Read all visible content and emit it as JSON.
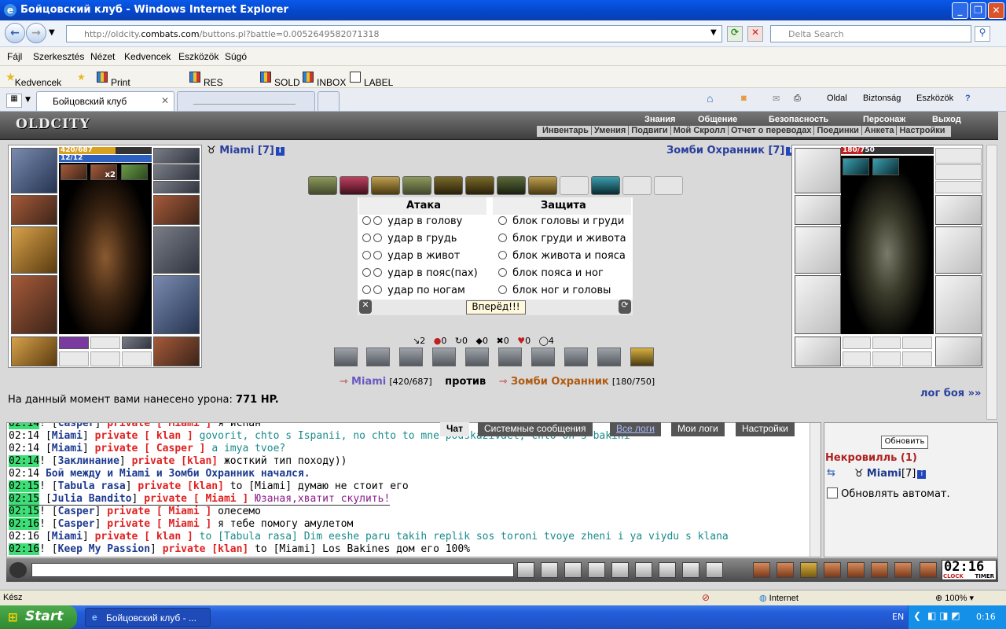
{
  "window": {
    "title": "Бойцовский клуб - Windows Internet Explorer"
  },
  "address": {
    "url_prefix": "http://oldcity.",
    "url_domain": "combats.com",
    "url_rest": "/buttons.pl?battle=0.0052649582071318",
    "search_placeholder": "Delta Search"
  },
  "menu": [
    "Fájl",
    "Szerkesztés",
    "Nézet",
    "Kedvencek",
    "Eszközök",
    "Súgó"
  ],
  "favorites": {
    "label": "Kedvencek",
    "items": [
      "Print Shipping label",
      "RES CENTER",
      "SOLD",
      "INBOX",
      "LABEL"
    ]
  },
  "tabs": [
    {
      "label": "Бойцовский клуб"
    },
    {
      "label": ""
    }
  ],
  "commandbar": [
    "Oldal",
    "Biztonság",
    "Eszközök"
  ],
  "game": {
    "logo": "OLDCITY",
    "nav_top": [
      "Знания",
      "Общение",
      "Безопасность",
      "Персонаж",
      "Выход"
    ],
    "nav_bottom": [
      "Инвентарь",
      "Умения",
      "Подвиги",
      "Мой Скролл",
      "Отчет о переводах",
      "Поединки",
      "Анкета",
      "Настройки"
    ],
    "player": {
      "name": "Miami [7]",
      "hp": "420/687",
      "mana": "12/12",
      "x2": "x2",
      "hp_fill": 0.61
    },
    "enemy": {
      "name": "Зомби Охранник [7]",
      "hp_cur": "180",
      "hp_max": "/750",
      "hp_fill": 0.24
    },
    "attack_header": "Атака",
    "defense_header": "Защита",
    "attacks": [
      "удар в голову",
      "удар в грудь",
      "удар в живот",
      "удар в пояс(пах)",
      "удар по ногам"
    ],
    "blocks": [
      "блок головы и груди",
      "блок груди и живота",
      "блок живота и пояса",
      "блок пояса и ног",
      "блок ног и головы"
    ],
    "go_button": "Вперёд!!!",
    "stats": [
      "2",
      "0",
      "0",
      "0",
      "0",
      "0",
      "4"
    ],
    "versus": {
      "p1": "Miami",
      "p1_hp": "[420/687]",
      "vs": "против",
      "p2": "Зомби Охранник",
      "p2_hp": "[180/750]"
    },
    "damage_text": "На данный момент вами нанесено урона:",
    "damage_value": "771 HP.",
    "log_link": "лог боя »»"
  },
  "chat_tabs": [
    "Чат",
    "Системные сообщения",
    "Все логи",
    "Мои логи",
    "Настройки"
  ],
  "chat": [
    {
      "time": "02:14",
      "hl": true,
      "user": "Casper",
      "priv": "private [ Miami ]",
      "text": "я испан",
      "color": "#000"
    },
    {
      "time": "02:14",
      "hl": false,
      "user": "Miami",
      "priv": "private [ klan ]",
      "text": "govorit, chto s Ispanii, no chto to mne podskazivaet, chto on s bakini",
      "color": "#1a8a8a"
    },
    {
      "time": "02:14",
      "hl": false,
      "user": "Miami",
      "priv": "private [ Casper ]",
      "text": "a imya tvoe?",
      "color": "#1a8a8a"
    },
    {
      "time": "02:14",
      "hl": true,
      "user": "Заклинание",
      "priv": "private [klan]",
      "text": "жосткий тип походу))",
      "color": "#000"
    },
    {
      "time": "02:14",
      "hl": false,
      "user": "",
      "priv": "",
      "text": "Бой между и Miami и Зомби Охранник начался.",
      "color": "#000"
    },
    {
      "time": "02:15",
      "hl": true,
      "user": "Tabula rasa",
      "priv": "private [klan]",
      "text": "to [Miami] думаю не стоит его",
      "color": "#000"
    },
    {
      "time": "02:15",
      "hl": true,
      "user": "Julia Bandito",
      "priv": "private [ Miami ]",
      "text": "Юзаная,хватит скулить!",
      "color": "#8a1a8a"
    },
    {
      "time": "02:15",
      "hl": true,
      "user": "Casper",
      "priv": "private [ Miami ]",
      "text": "олесемо",
      "color": "#000"
    },
    {
      "time": "02:16",
      "hl": true,
      "user": "Casper",
      "priv": "private [ Miami ]",
      "text": "я тебе помогу амулетом",
      "color": "#000"
    },
    {
      "time": "02:16",
      "hl": false,
      "user": "Miami",
      "priv": "private [ klan ]",
      "text": "to [Tabula rasa] Dim eeshe paru takih replik sos toroni tvoye zheni i ya viydu s klana",
      "color": "#1a8a8a"
    },
    {
      "time": "02:16",
      "hl": true,
      "user": "Keep My Passion",
      "priv": "private [klan]",
      "text": "to [Miami] Los Bakines дом его 100%",
      "color": "#000"
    }
  ],
  "side": {
    "refresh": "Обновить",
    "location": "Некровилль (1)",
    "user": "Miami",
    "level": "[7]",
    "auto": "Обновлять автомат."
  },
  "clock": "02:16",
  "clock_labels": [
    "CLOCK",
    "TIMER"
  ],
  "statusbar": {
    "left": "Kész",
    "zone": "Internet",
    "zoom": "100%"
  },
  "taskbar": {
    "start": "Start",
    "task": "Бойцовский клуб - ...",
    "lang": "EN",
    "time": "0:16"
  }
}
